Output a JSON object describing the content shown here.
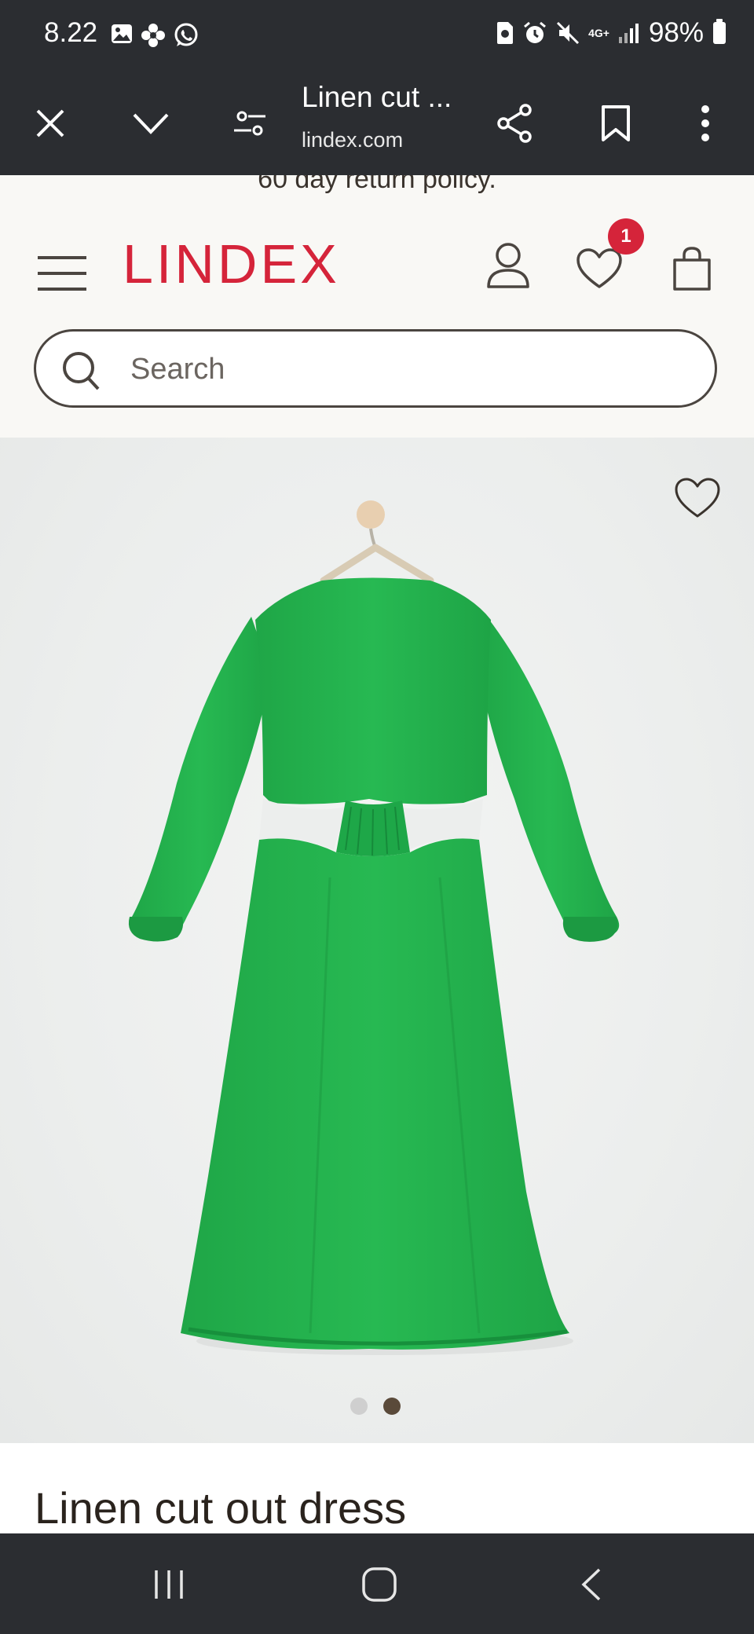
{
  "status_bar": {
    "time": "8.22",
    "network": "4G+",
    "battery": "98%"
  },
  "browser": {
    "title": "Linen cut ...",
    "domain": "lindex.com"
  },
  "header": {
    "promo": "60 day return policy.",
    "logo": "LINDEX",
    "wishlist_count": "1",
    "search_placeholder": "Search"
  },
  "product": {
    "title": "Linen cut out dress",
    "image_index": 2,
    "image_count": 2
  },
  "colors": {
    "brand": "#d5243a",
    "dress": "#22b24c",
    "system_bar": "#2b2d31"
  }
}
